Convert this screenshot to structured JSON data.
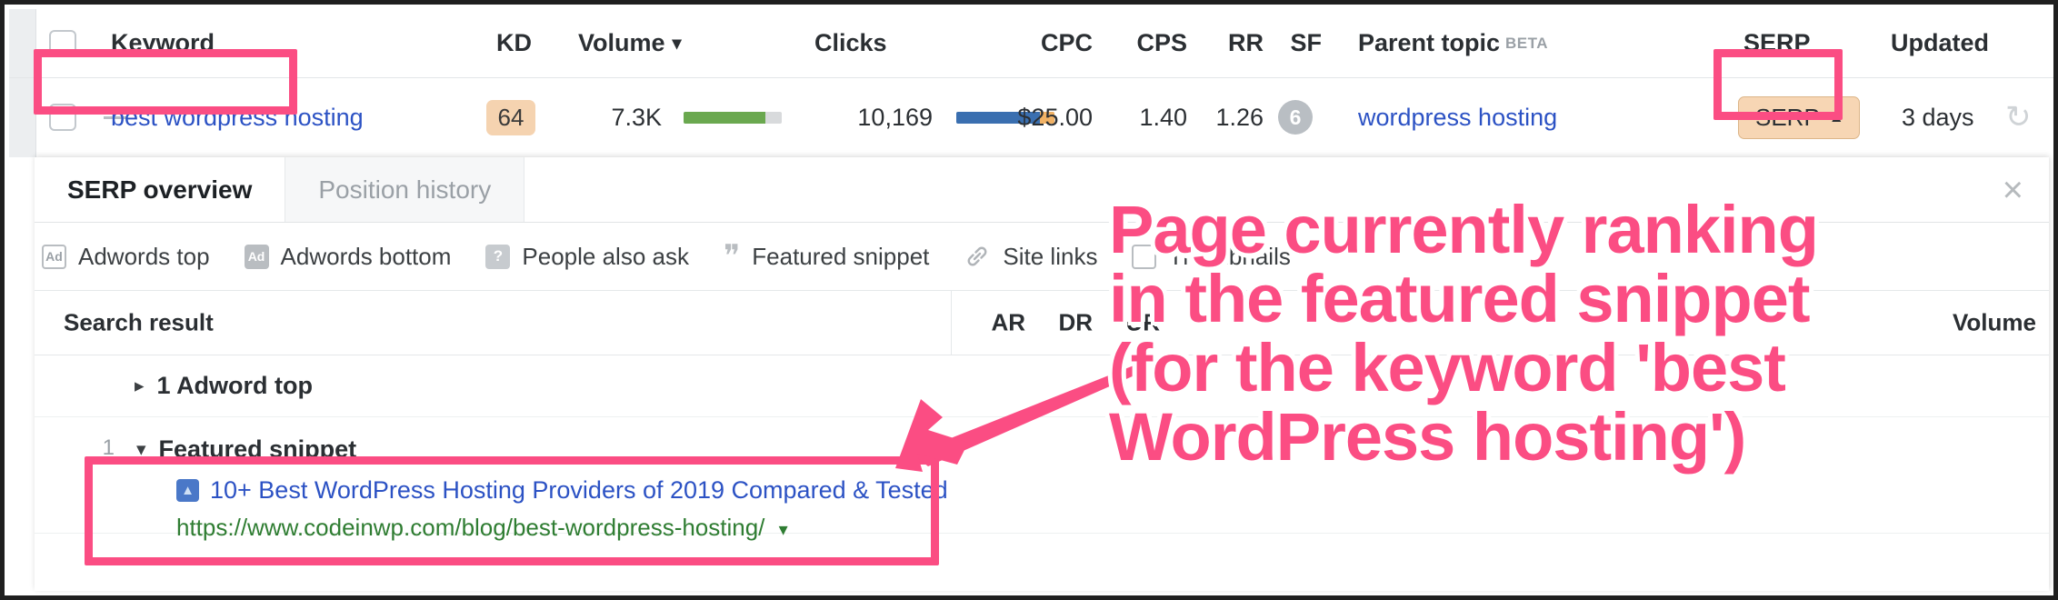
{
  "keyword_table": {
    "columns": [
      {
        "key": "keyword",
        "label": "Keyword"
      },
      {
        "key": "kd",
        "label": "KD"
      },
      {
        "key": "volume",
        "label": "Volume",
        "sorted": "desc",
        "sort_glyph": "▾"
      },
      {
        "key": "clicks",
        "label": "Clicks"
      },
      {
        "key": "cpc",
        "label": "CPC"
      },
      {
        "key": "cps",
        "label": "CPS"
      },
      {
        "key": "rr",
        "label": "RR"
      },
      {
        "key": "sf",
        "label": "SF"
      },
      {
        "key": "parent_topic",
        "label": "Parent topic",
        "badge": "BETA"
      },
      {
        "key": "serp",
        "label": "SERP"
      },
      {
        "key": "updated",
        "label": "Updated"
      }
    ],
    "row": {
      "keyword": "best wordpress hosting",
      "kd": "64",
      "volume": "7.3K",
      "volume_bar_pct": 83,
      "clicks": "10,169",
      "clicks_bar_blue_pct": 85,
      "clicks_bar_orange_pct": 15,
      "cpc": "$25.00",
      "cps": "1.40",
      "rr": "1.26",
      "sf": "6",
      "parent_topic": "wordpress hosting",
      "serp_button": "SERP",
      "serp_caret": "▲",
      "updated": "3 days",
      "refresh_icon": "↻"
    }
  },
  "serp_panel": {
    "tabs": [
      {
        "label": "SERP overview",
        "active": true
      },
      {
        "label": "Position history",
        "active": false
      }
    ],
    "close_label": "×",
    "features": [
      {
        "label": "Adwords top",
        "icon": "adwords-top-icon",
        "glyph": "Ad"
      },
      {
        "label": "Adwords bottom",
        "icon": "adwords-bottom-icon",
        "glyph": "Ad"
      },
      {
        "label": "People also ask",
        "icon": "people-also-ask-icon",
        "glyph": "?"
      },
      {
        "label": "Featured snippet",
        "icon": "quote-icon",
        "glyph": "”"
      },
      {
        "label": "Site links",
        "icon": "link-icon",
        "glyph": "🔗"
      },
      {
        "label": "Thumbnails",
        "icon": "thumbnail-icon",
        "glyph": ""
      }
    ],
    "result_header": {
      "search_result": "Search result",
      "ar": "AR",
      "dr": "DR",
      "ur": "UR",
      "traffic": "Volume"
    },
    "results": [
      {
        "type": "adword",
        "index": "",
        "toggle": "▸",
        "title": "1 Adword top"
      },
      {
        "type": "featured_snippet",
        "index": "1",
        "toggle": "▾",
        "title": "Featured snippet",
        "result_title": "10+ Best WordPress Hosting Providers of 2019 Compared & Tested",
        "result_url": "https://www.codeinwp.com/blog/best-wordpress-hosting/",
        "url_caret": "▾"
      }
    ]
  },
  "annotations": {
    "callout_text": "Page currently ranking\nin the featured snippet\n(for the keyword 'best\nWordPress hosting')",
    "accent_color": "#fb4d83",
    "highlight_keyword": "best wordpress hosting",
    "highlight_serp_button": "SERP",
    "highlight_featured_snippet": "Featured snippet"
  }
}
